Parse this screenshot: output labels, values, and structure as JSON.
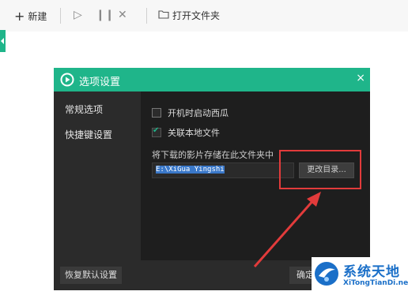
{
  "toolbar": {
    "new_label": "新建",
    "open_folder_label": "打开文件夹",
    "icons": [
      "plus-icon",
      "play-icon",
      "pause-icon",
      "close-icon",
      "folder-icon"
    ]
  },
  "dialog": {
    "title": "选项设置",
    "close_glyph": "×",
    "nav": [
      "常规选项",
      "快捷键设置"
    ],
    "options": [
      {
        "label": "开机时启动西瓜",
        "checked": false
      },
      {
        "label": "关联本地文件",
        "checked": true
      }
    ],
    "download_folder_label": "将下载的影片存储在此文件夹中",
    "download_path": "E:\\XiGua Yingshi",
    "change_dir_label": "更改目录...",
    "reset_label": "恢复默认设置",
    "ok_label": "确定"
  },
  "watermark": {
    "cn": "系统天地",
    "en": "XiTongTianDi.net"
  },
  "colors": {
    "accent": "#1fb58a",
    "dialog_bg": "#2b2b2b",
    "content_bg": "#1e1e1e",
    "annotation": "#e23b3b",
    "watermark": "#1a6fc8"
  }
}
